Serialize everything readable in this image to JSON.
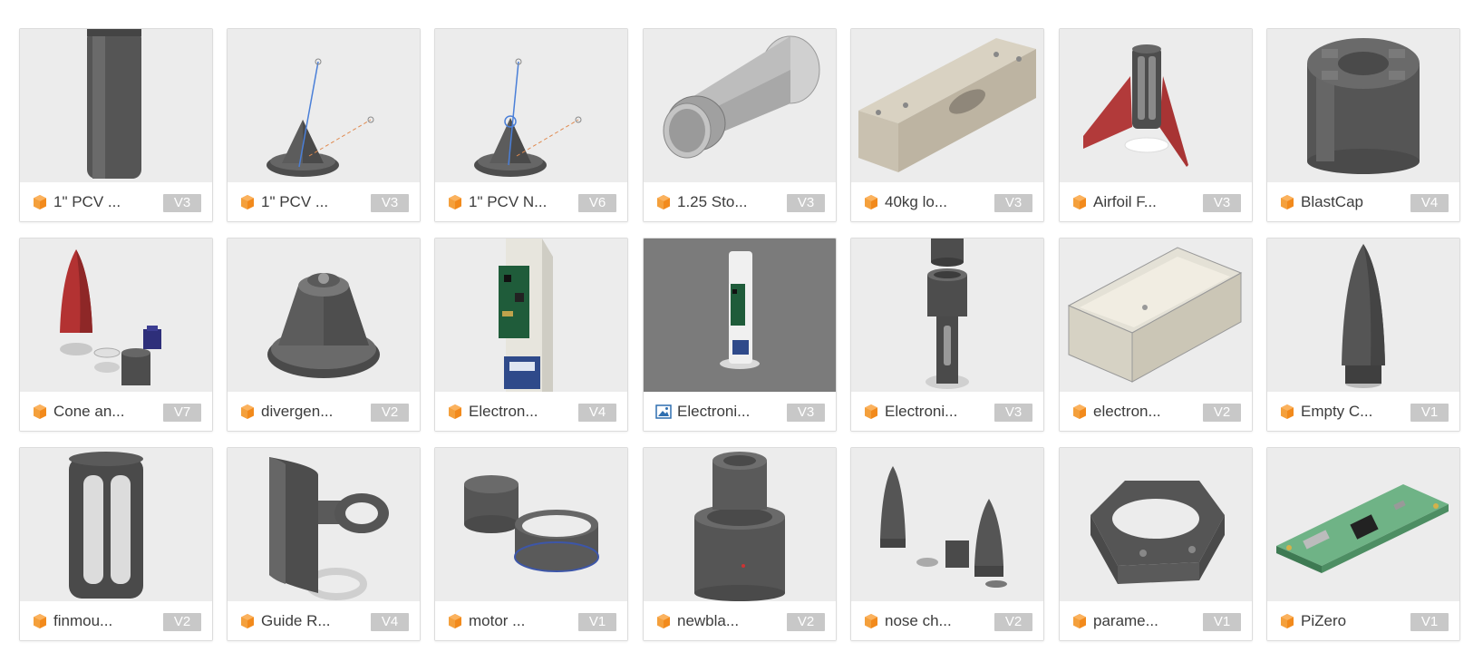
{
  "colors": {
    "fusion_design_icon": "#f28a1c",
    "image_icon": "#2f6fb0",
    "thumbnail_bg": "#ececec",
    "thumbnail_bg_dark": "#7b7b7b",
    "version_badge_bg": "#c8c8c8"
  },
  "items": [
    {
      "name": "1\" PCV ...",
      "version": "V3",
      "icon": "design-icon"
    },
    {
      "name": "1\" PCV ...",
      "version": "V3",
      "icon": "design-icon"
    },
    {
      "name": "1\" PCV N...",
      "version": "V6",
      "icon": "design-icon"
    },
    {
      "name": "1.25 Sto...",
      "version": "V3",
      "icon": "design-icon"
    },
    {
      "name": "40kg lo...",
      "version": "V3",
      "icon": "design-icon"
    },
    {
      "name": "Airfoil F...",
      "version": "V3",
      "icon": "design-icon"
    },
    {
      "name": "BlastCap",
      "version": "V4",
      "icon": "design-icon"
    },
    {
      "name": "Cone an...",
      "version": "V7",
      "icon": "design-icon"
    },
    {
      "name": "divergen...",
      "version": "V2",
      "icon": "design-icon"
    },
    {
      "name": "Electron...",
      "version": "V4",
      "icon": "design-icon"
    },
    {
      "name": "Electroni...",
      "version": "V3",
      "icon": "image-icon"
    },
    {
      "name": "Electroni...",
      "version": "V3",
      "icon": "design-icon"
    },
    {
      "name": "electron...",
      "version": "V2",
      "icon": "design-icon"
    },
    {
      "name": "Empty C...",
      "version": "V1",
      "icon": "design-icon"
    },
    {
      "name": "finmou...",
      "version": "V2",
      "icon": "design-icon"
    },
    {
      "name": "Guide R...",
      "version": "V4",
      "icon": "design-icon"
    },
    {
      "name": "motor ...",
      "version": "V1",
      "icon": "design-icon"
    },
    {
      "name": "newbla...",
      "version": "V2",
      "icon": "design-icon"
    },
    {
      "name": "nose ch...",
      "version": "V2",
      "icon": "design-icon"
    },
    {
      "name": "parame...",
      "version": "V1",
      "icon": "design-icon"
    },
    {
      "name": "PiZero",
      "version": "V1",
      "icon": "design-icon"
    }
  ]
}
